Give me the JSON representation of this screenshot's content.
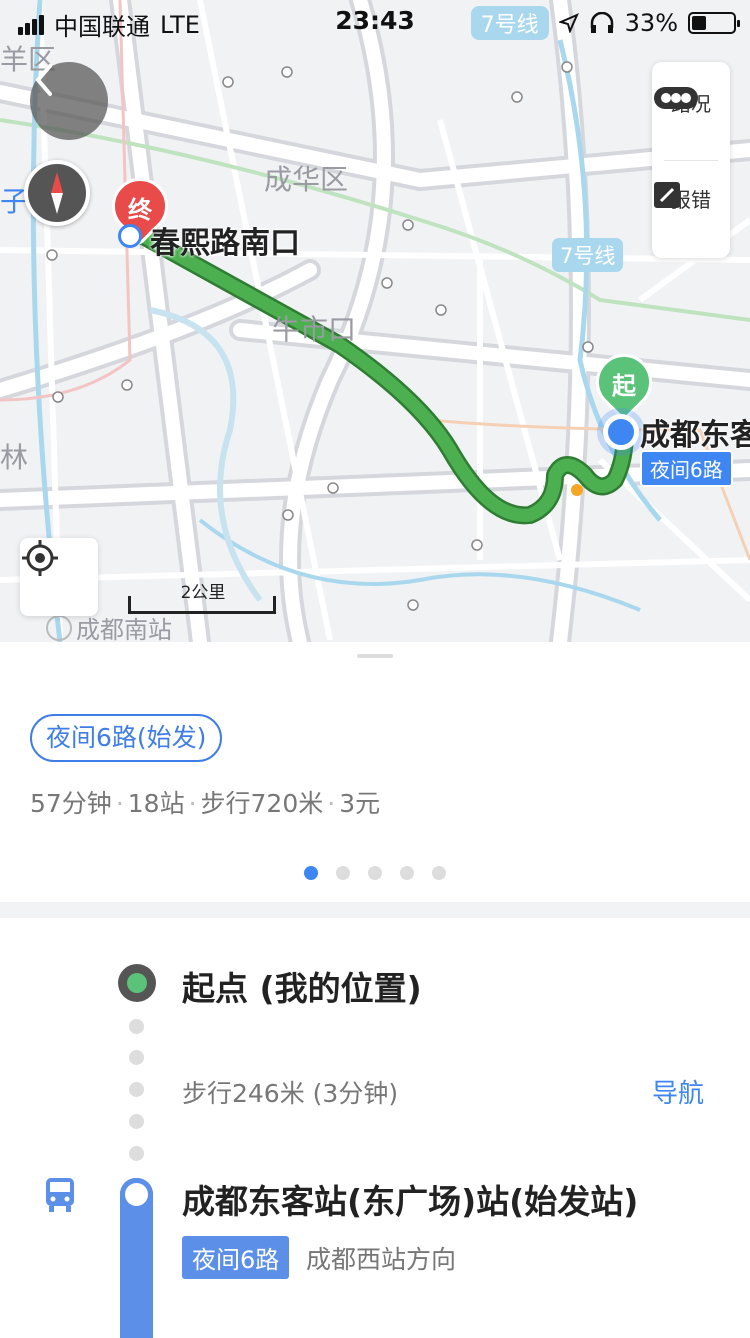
{
  "status_bar": {
    "carrier": "中国联通",
    "network": "LTE",
    "time": "23:43",
    "line_pill": "7号线",
    "battery": "33%"
  },
  "map": {
    "district_labels": [
      "羊区",
      "成华区",
      "牛市口",
      "林",
      "子"
    ],
    "metro_line_label": "7号线",
    "end_marker": "终",
    "start_marker": "起",
    "end_place": "春熙路南口",
    "start_place": "成都东客",
    "start_route_tag": "夜间6路",
    "south_station": "成都南站",
    "scale_label": "2公里",
    "route_color": "#4caf50",
    "side_panel": {
      "traffic_label": "路况",
      "report_label": "报错"
    }
  },
  "route_card": {
    "route_chip": "夜间6路(始发)",
    "duration": "57分钟",
    "stops": "18站",
    "walk": "步行720米",
    "fare": "3元",
    "page_count": 5,
    "active_page": 0
  },
  "steps": {
    "start_title": "起点 (我的位置)",
    "walk_text": "步行246米 (3分钟)",
    "nav_label": "导航",
    "board_station": "成都东客站(东广场)站(始发站)",
    "line_badge": "夜间6路",
    "direction": "成都西站方向"
  },
  "colors": {
    "accent": "#3e86f2",
    "start_green": "#5bc27a",
    "end_red": "#e94a4a",
    "bus_blue": "#5b8fe8"
  }
}
